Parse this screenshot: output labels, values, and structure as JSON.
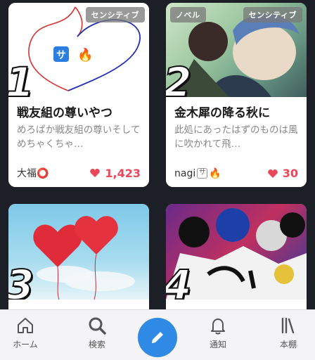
{
  "cards": [
    {
      "rank": "1",
      "badge": "センシティブ",
      "title": "戦友組の尊いやつ",
      "desc": "めろぱか戦友組の尊いそしてめちゃくちゃ…",
      "author": "大福⭕",
      "likes": "1,423",
      "thumb_icons": [
        "サ",
        "🔥"
      ]
    },
    {
      "rank": "2",
      "category": "ノベル",
      "badge": "センシティブ",
      "title": "金木犀の降る秋に",
      "desc": "此処にあったはずのものは風に吹かれて飛…",
      "author": "nagi",
      "author_badges": [
        "サ",
        "🔥"
      ],
      "likes": "30"
    },
    {
      "rank": "3"
    },
    {
      "rank": "4"
    }
  ],
  "tabs": {
    "home": "ホーム",
    "search": "検索",
    "notify": "通知",
    "shelf": "本棚"
  },
  "colors": {
    "accent": "#2f8ae6",
    "heart": "#e8485a",
    "background": "#1c1f26"
  }
}
